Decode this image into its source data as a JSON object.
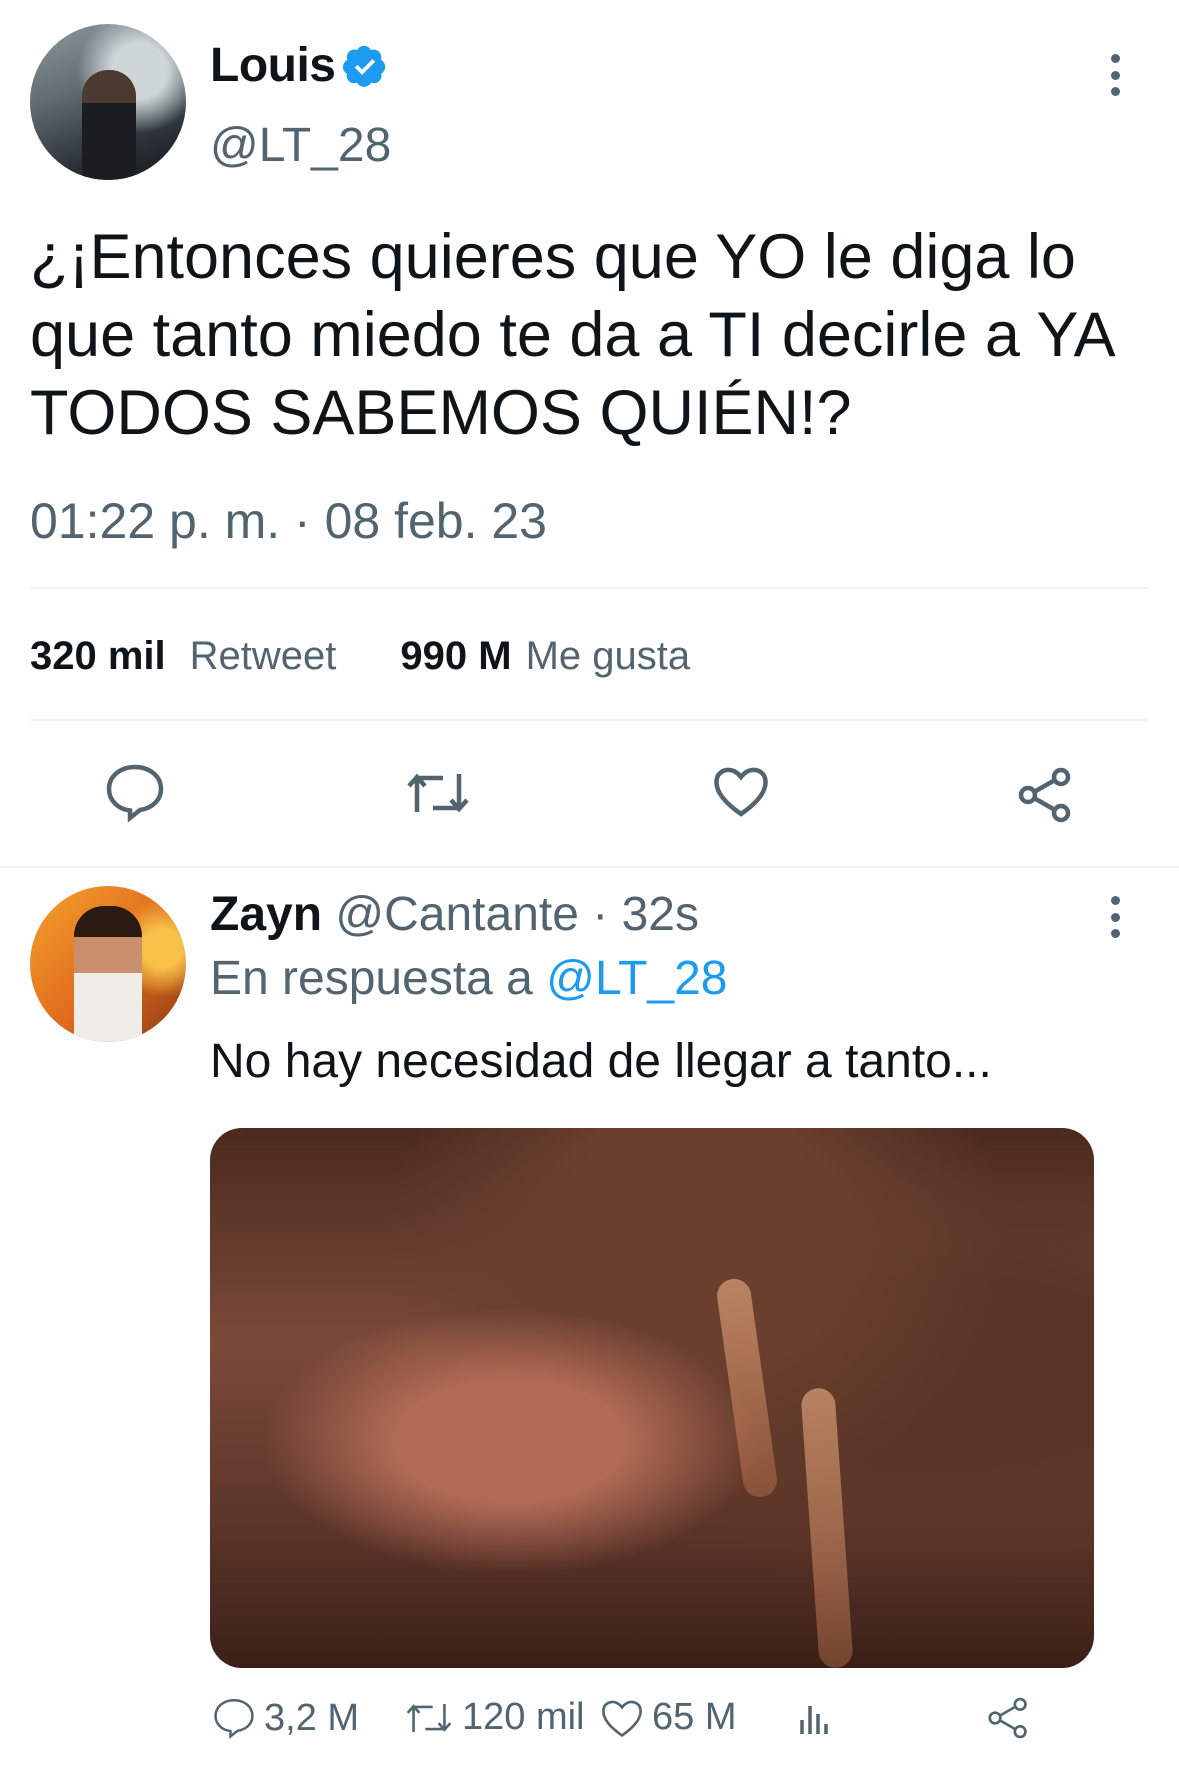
{
  "tweet": {
    "author_name": "Louis",
    "author_handle": "@LT_28",
    "text": "¿¡Entonces quieres que YO le diga lo que tanto miedo te da a TI decirle a YA TODOS SABEMOS QUIÉN!?",
    "timestamp": "01:22 p. m. · 08 feb. 23",
    "retweets_count": "320 mil",
    "retweets_label": "Retweet",
    "likes_count": "990 M",
    "likes_label": "Me gusta"
  },
  "reply": {
    "author_name": "Zayn",
    "author_handle": "@Cantante",
    "time": "· 32s",
    "replying_prefix": "En respuesta a",
    "replying_to": "@LT_28",
    "text": "No hay necesidad de llegar a tanto...",
    "counts": {
      "replies": "3,2 M",
      "retweets": "120 mil",
      "likes": "65 M"
    }
  },
  "colors": {
    "accent": "#1d9bf0",
    "secondary_text": "#536471",
    "primary_text": "#0f1419"
  },
  "icons": [
    "verified-badge-icon",
    "more-options-icon",
    "reply-icon",
    "retweet-icon",
    "like-icon",
    "share-icon",
    "analytics-icon"
  ]
}
